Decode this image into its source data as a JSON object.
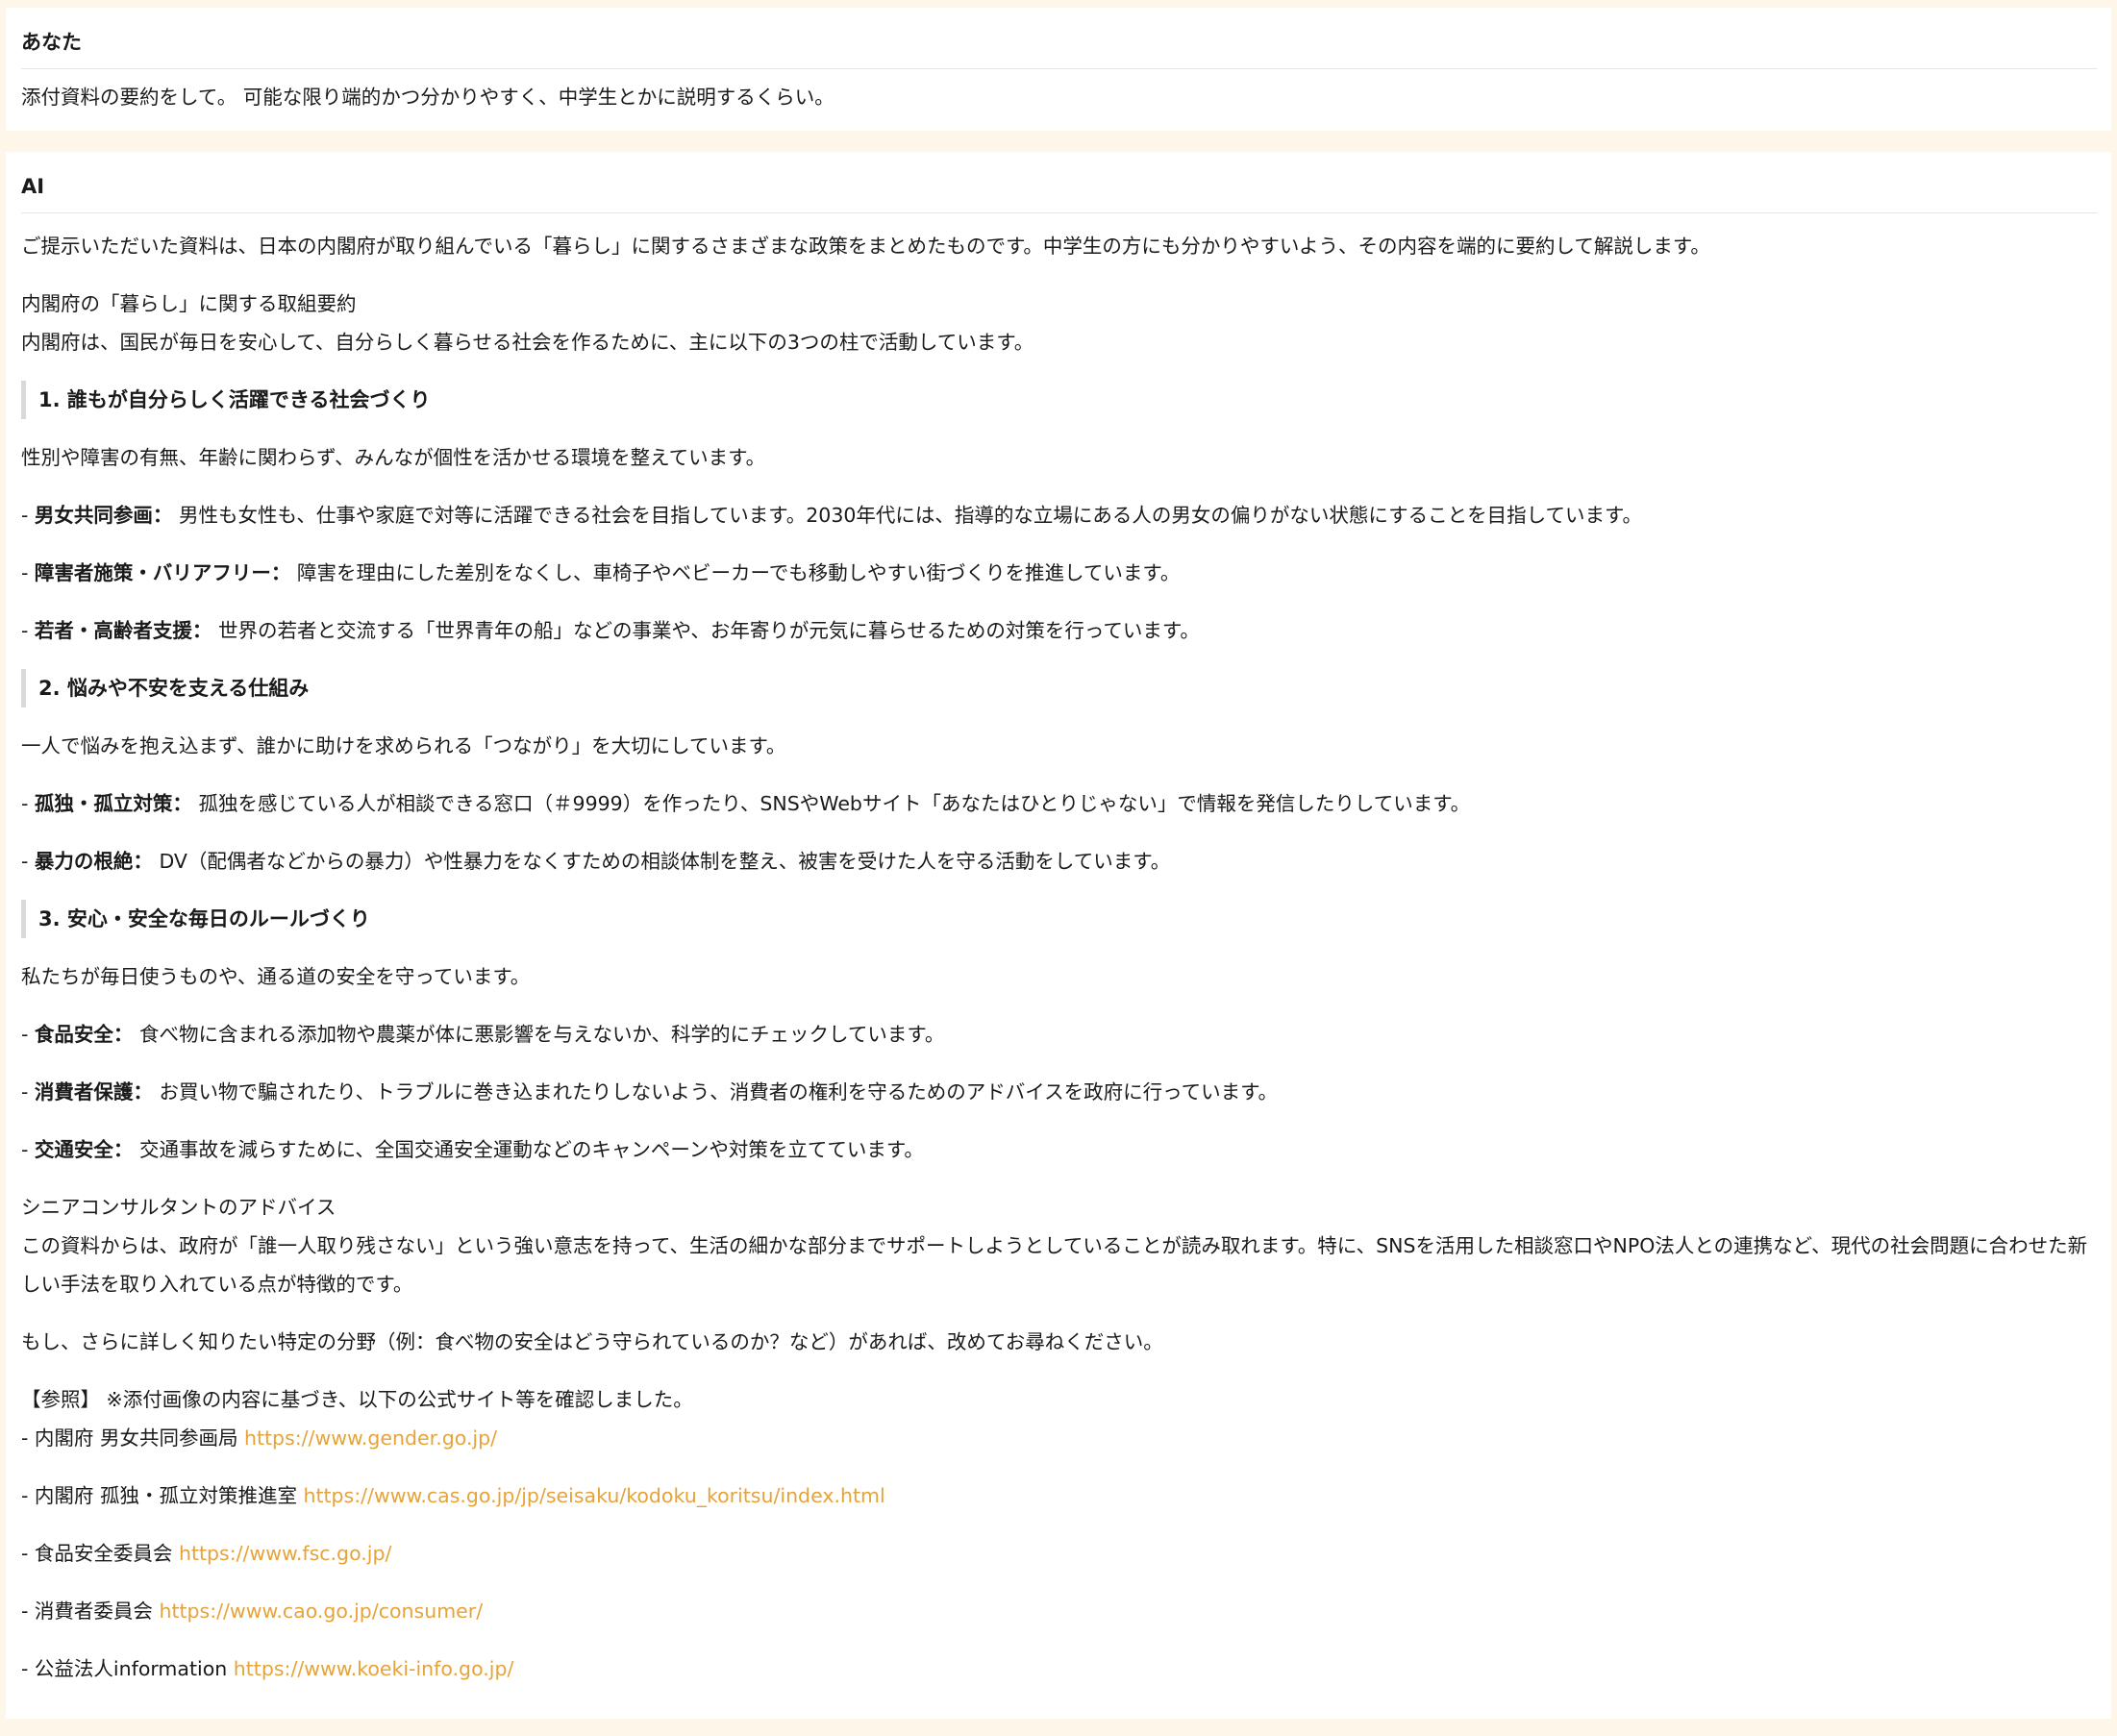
{
  "user_message": {
    "sender": "あなた",
    "text": "添付資料の要約をして。 可能な限り端的かつ分かりやすく、中学生とかに説明するくらい。"
  },
  "ai_message": {
    "sender": "AI",
    "intro": "ご提示いただいた資料は、日本の内閣府が取り組んでいる「暮らし」に関するさまざまな政策をまとめたものです。中学生の方にも分かりやすいよう、その内容を端的に要約して解説します。",
    "summary_title": "内閣府の「暮らし」に関する取組要約",
    "summary_lead": "内閣府は、国民が毎日を安心して、自分らしく暮らせる社会を作るために、主に以下の3つの柱で活動しています。",
    "sections": [
      {
        "heading": "1. 誰もが自分らしく活躍できる社会づくり",
        "lead": "性別や障害の有無、年齢に関わらず、みんなが個性を活かせる環境を整えています。",
        "items": [
          {
            "term": "男女共同参画：",
            "desc": "男性も女性も、仕事や家庭で対等に活躍できる社会を目指しています。2030年代には、指導的な立場にある人の男女の偏りがない状態にすることを目指しています。"
          },
          {
            "term": "障害者施策・バリアフリー：",
            "desc": "障害を理由にした差別をなくし、車椅子やベビーカーでも移動しやすい街づくりを推進しています。"
          },
          {
            "term": "若者・高齢者支援：",
            "desc": "世界の若者と交流する「世界青年の船」などの事業や、お年寄りが元気に暮らせるための対策を行っています。"
          }
        ]
      },
      {
        "heading": "2. 悩みや不安を支える仕組み",
        "lead": "一人で悩みを抱え込まず、誰かに助けを求められる「つながり」を大切にしています。",
        "items": [
          {
            "term": "孤独・孤立対策：",
            "desc": "孤独を感じている人が相談できる窓口（＃9999）を作ったり、SNSやWebサイト「あなたはひとりじゃない」で情報を発信したりしています。"
          },
          {
            "term": "暴力の根絶：",
            "desc": "DV（配偶者などからの暴力）や性暴力をなくすための相談体制を整え、被害を受けた人を守る活動をしています。"
          }
        ]
      },
      {
        "heading": "3. 安心・安全な毎日のルールづくり",
        "lead": "私たちが毎日使うものや、通る道の安全を守っています。",
        "items": [
          {
            "term": "食品安全：",
            "desc": "食べ物に含まれる添加物や農薬が体に悪影響を与えないか、科学的にチェックしています。"
          },
          {
            "term": "消費者保護：",
            "desc": "お買い物で騙されたり、トラブルに巻き込まれたりしないよう、消費者の権利を守るためのアドバイスを政府に行っています。"
          },
          {
            "term": "交通安全：",
            "desc": "交通事故を減らすために、全国交通安全運動などのキャンペーンや対策を立てています。"
          }
        ]
      }
    ],
    "advice_title": "シニアコンサルタントのアドバイス",
    "advice_text": "この資料からは、政府が「誰一人取り残さない」という強い意志を持って、生活の細かな部分までサポートしようとしていることが読み取れます。特に、SNSを活用した相談窓口やNPO法人との連携など、現代の社会問題に合わせた新しい手法を取り入れている点が特徴的です。",
    "closing": "もし、さらに詳しく知りたい特定の分野（例：食べ物の安全はどう守られているのか？など）があれば、改めてお尋ねください。",
    "references_title": "【参照】 ※添付画像の内容に基づき、以下の公式サイト等を確認しました。",
    "references": [
      {
        "name": "内閣府 男女共同参画局",
        "url": "https://www.gender.go.jp/"
      },
      {
        "name": "内閣府 孤独・孤立対策推進室",
        "url": "https://www.cas.go.jp/jp/seisaku/kodoku_koritsu/index.html"
      },
      {
        "name": "食品安全委員会",
        "url": "https://www.fsc.go.jp/"
      },
      {
        "name": "消費者委員会",
        "url": "https://www.cao.go.jp/consumer/"
      },
      {
        "name": "公益法人information",
        "url": "https://www.koeki-info.go.jp/"
      }
    ],
    "colors": {
      "page_background": "#fdf6e9",
      "card_background": "#ffffff",
      "link": "#e6a33a",
      "heading_bar": "#d9d9d9"
    }
  }
}
